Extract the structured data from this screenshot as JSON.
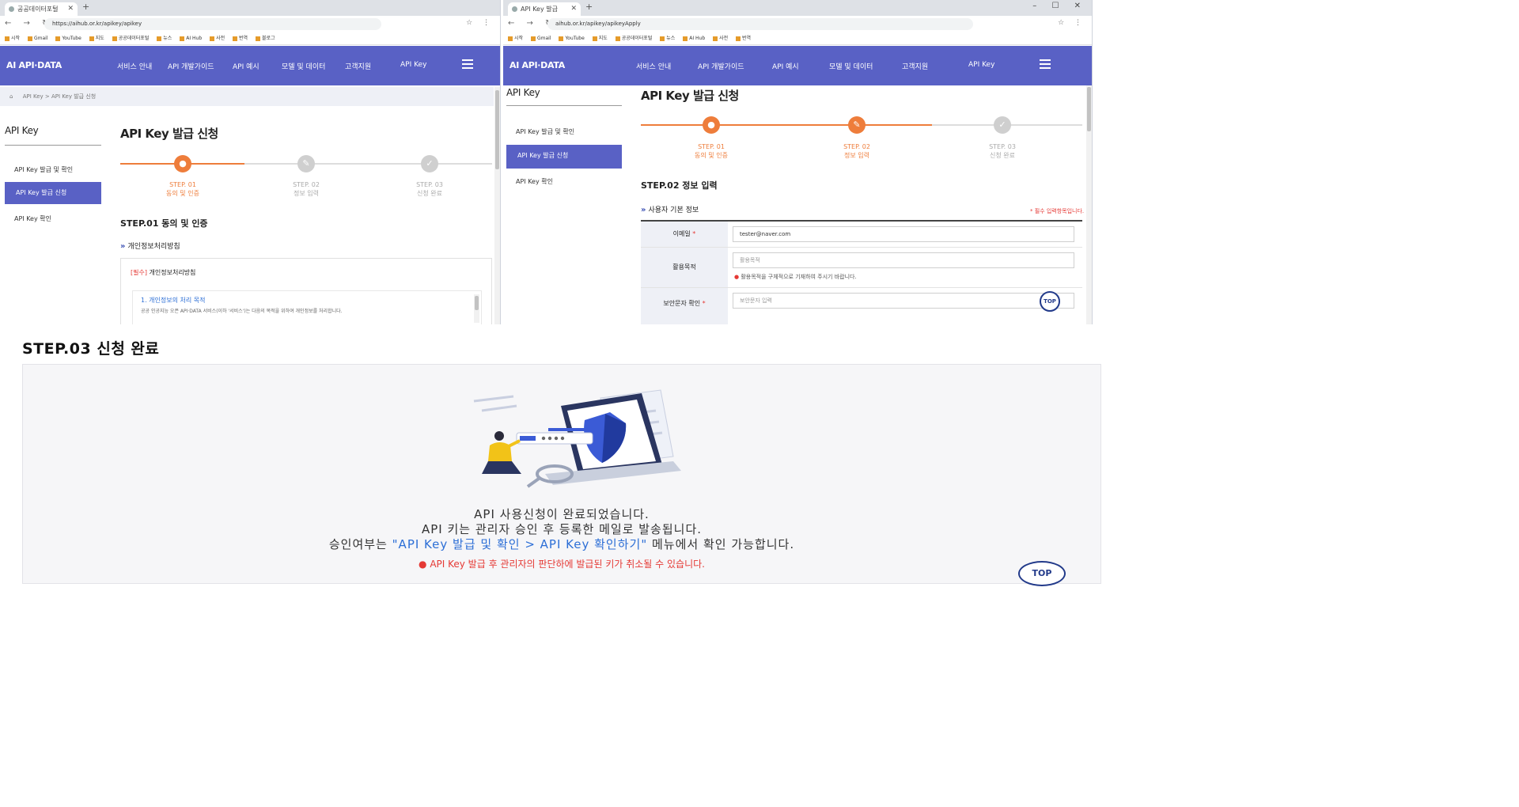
{
  "left_window": {
    "tab_title": "공공데이터포털",
    "url": "https://aihub.or.kr/apikey/apikey",
    "bookmarks": [
      "시작",
      "Gmail",
      "YouTube",
      "지도",
      "공공데이터포털",
      "뉴스",
      "AI Hub",
      "사전",
      "번역",
      "블로그"
    ],
    "logo": "AI API·DATA",
    "nav": [
      "서비스 안내",
      "API 개발가이드",
      "API 예시",
      "모델 및 데이터",
      "고객지원",
      "API Key"
    ],
    "breadcrumb": "API Key  >  API Key 발급 신청",
    "sidebar_title": "API Key",
    "sidebar_items": [
      "API Key 발급 및 확인",
      "API Key 발급 신청",
      "API Key 확인"
    ],
    "page_title": "API Key 발급 신청",
    "steps": [
      {
        "num": "STEP. 01",
        "label": "동의 및 인증"
      },
      {
        "num": "STEP. 02",
        "label": "정보 입력"
      },
      {
        "num": "STEP. 03",
        "label": "신청 완료"
      }
    ],
    "section_title": "STEP.01 동의 및 인증",
    "privacy_heading": "개인정보처리방침",
    "required_tag": "[필수]",
    "privacy_label": "개인정보처리방침",
    "privacy_item": "1. 개인정보의 처리 목적",
    "privacy_text": "공공 인공지능 오픈 API·DATA 서비스(이하 '서비스')는 다음의 목적을 위하여 개인정보를 처리합니다."
  },
  "right_window": {
    "tab_title": "API Key 발급",
    "url": "aihub.or.kr/apikey/apikeyApply",
    "bookmarks": [
      "시작",
      "Gmail",
      "YouTube",
      "지도",
      "공공데이터포털",
      "뉴스",
      "AI Hub",
      "사전",
      "번역"
    ],
    "logo": "AI API·DATA",
    "nav": [
      "서비스 안내",
      "API 개발가이드",
      "API 예시",
      "모델 및 데이터",
      "고객지원",
      "API Key"
    ],
    "sidebar_title": "API Key",
    "sidebar_items": [
      "API Key 발급 및 확인",
      "API Key 발급 신청",
      "API Key 확인"
    ],
    "page_title": "API Key 발급 신청",
    "steps": [
      {
        "num": "STEP. 01",
        "label": "동의 및 인증"
      },
      {
        "num": "STEP. 02",
        "label": "정보 입력"
      },
      {
        "num": "STEP. 03",
        "label": "신청 완료"
      }
    ],
    "section_title": "STEP.02 정보 입력",
    "applicant_heading": "사용자 기본 정보",
    "required_note": "* 필수 입력항목입니다.",
    "email_label": "이메일",
    "email_value": "tester@naver.com",
    "purpose_label": "활용목적",
    "purpose_placeholder": "활용목적",
    "purpose_warning": "활용목적을 구체적으로 기재하여 주시기 바랍니다.",
    "captcha_label": "보안문자 확인",
    "captcha_placeholder": "보안문자 입력",
    "top_label": "TOP"
  },
  "step3": {
    "heading": "STEP.03 신청 완료",
    "line1": "API 사용신청이 완료되었습니다.",
    "line2": "API 키는 관리자 승인 후 등록한 메일로 발송됩니다.",
    "line3_prefix": "승인여부는 ",
    "line3_link": "\"API Key 발급 및 확인 > API Key 확인하기\"",
    "line3_suffix": " 메뉴에서 확인 가능합니다.",
    "warning": "API Key 발급 후 관리자의 판단하에 발급된 키가 취소될 수 있습니다.",
    "top_label": "TOP"
  },
  "colors": {
    "nav": "#5961c5",
    "step_active": "#ee7d3b",
    "link": "#2d6fd6",
    "warning": "#e53935"
  }
}
